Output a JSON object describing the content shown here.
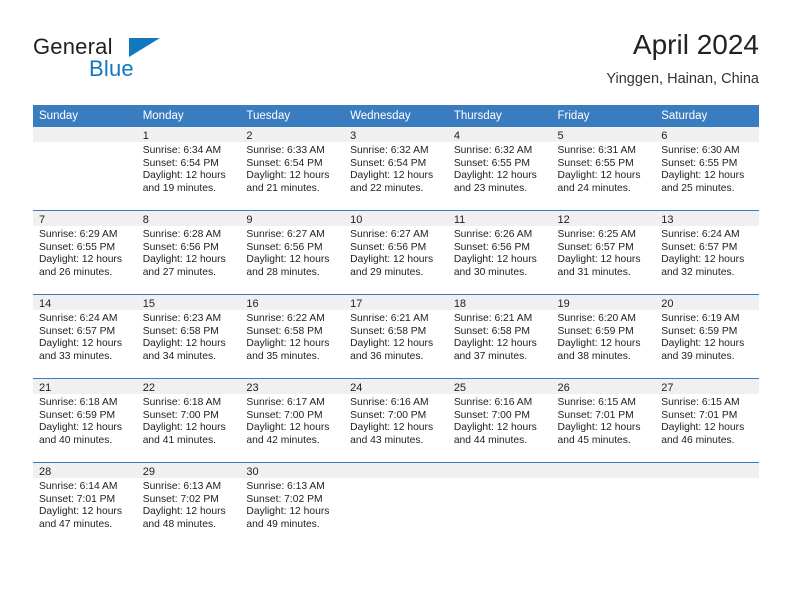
{
  "brand": {
    "word_one": "General",
    "word_two": "Blue",
    "triangle_icon": "triangle-icon",
    "accent_color": "#1278be"
  },
  "header": {
    "title": "April 2024",
    "subtitle": "Yinggen, Hainan, China"
  },
  "theme": {
    "header_blue": "#3a7cc0",
    "daynum_band": "#f0f0f0",
    "text": "#222222"
  },
  "calendar": {
    "weekday_headers": [
      "Sunday",
      "Monday",
      "Tuesday",
      "Wednesday",
      "Thursday",
      "Friday",
      "Saturday"
    ],
    "weeks": [
      [
        {
          "day": "",
          "sunrise": "",
          "sunset": "",
          "daylight_1": "",
          "daylight_2": ""
        },
        {
          "day": "1",
          "sunrise": "Sunrise: 6:34 AM",
          "sunset": "Sunset: 6:54 PM",
          "daylight_1": "Daylight: 12 hours",
          "daylight_2": "and 19 minutes."
        },
        {
          "day": "2",
          "sunrise": "Sunrise: 6:33 AM",
          "sunset": "Sunset: 6:54 PM",
          "daylight_1": "Daylight: 12 hours",
          "daylight_2": "and 21 minutes."
        },
        {
          "day": "3",
          "sunrise": "Sunrise: 6:32 AM",
          "sunset": "Sunset: 6:54 PM",
          "daylight_1": "Daylight: 12 hours",
          "daylight_2": "and 22 minutes."
        },
        {
          "day": "4",
          "sunrise": "Sunrise: 6:32 AM",
          "sunset": "Sunset: 6:55 PM",
          "daylight_1": "Daylight: 12 hours",
          "daylight_2": "and 23 minutes."
        },
        {
          "day": "5",
          "sunrise": "Sunrise: 6:31 AM",
          "sunset": "Sunset: 6:55 PM",
          "daylight_1": "Daylight: 12 hours",
          "daylight_2": "and 24 minutes."
        },
        {
          "day": "6",
          "sunrise": "Sunrise: 6:30 AM",
          "sunset": "Sunset: 6:55 PM",
          "daylight_1": "Daylight: 12 hours",
          "daylight_2": "and 25 minutes."
        }
      ],
      [
        {
          "day": "7",
          "sunrise": "Sunrise: 6:29 AM",
          "sunset": "Sunset: 6:55 PM",
          "daylight_1": "Daylight: 12 hours",
          "daylight_2": "and 26 minutes."
        },
        {
          "day": "8",
          "sunrise": "Sunrise: 6:28 AM",
          "sunset": "Sunset: 6:56 PM",
          "daylight_1": "Daylight: 12 hours",
          "daylight_2": "and 27 minutes."
        },
        {
          "day": "9",
          "sunrise": "Sunrise: 6:27 AM",
          "sunset": "Sunset: 6:56 PM",
          "daylight_1": "Daylight: 12 hours",
          "daylight_2": "and 28 minutes."
        },
        {
          "day": "10",
          "sunrise": "Sunrise: 6:27 AM",
          "sunset": "Sunset: 6:56 PM",
          "daylight_1": "Daylight: 12 hours",
          "daylight_2": "and 29 minutes."
        },
        {
          "day": "11",
          "sunrise": "Sunrise: 6:26 AM",
          "sunset": "Sunset: 6:56 PM",
          "daylight_1": "Daylight: 12 hours",
          "daylight_2": "and 30 minutes."
        },
        {
          "day": "12",
          "sunrise": "Sunrise: 6:25 AM",
          "sunset": "Sunset: 6:57 PM",
          "daylight_1": "Daylight: 12 hours",
          "daylight_2": "and 31 minutes."
        },
        {
          "day": "13",
          "sunrise": "Sunrise: 6:24 AM",
          "sunset": "Sunset: 6:57 PM",
          "daylight_1": "Daylight: 12 hours",
          "daylight_2": "and 32 minutes."
        }
      ],
      [
        {
          "day": "14",
          "sunrise": "Sunrise: 6:24 AM",
          "sunset": "Sunset: 6:57 PM",
          "daylight_1": "Daylight: 12 hours",
          "daylight_2": "and 33 minutes."
        },
        {
          "day": "15",
          "sunrise": "Sunrise: 6:23 AM",
          "sunset": "Sunset: 6:58 PM",
          "daylight_1": "Daylight: 12 hours",
          "daylight_2": "and 34 minutes."
        },
        {
          "day": "16",
          "sunrise": "Sunrise: 6:22 AM",
          "sunset": "Sunset: 6:58 PM",
          "daylight_1": "Daylight: 12 hours",
          "daylight_2": "and 35 minutes."
        },
        {
          "day": "17",
          "sunrise": "Sunrise: 6:21 AM",
          "sunset": "Sunset: 6:58 PM",
          "daylight_1": "Daylight: 12 hours",
          "daylight_2": "and 36 minutes."
        },
        {
          "day": "18",
          "sunrise": "Sunrise: 6:21 AM",
          "sunset": "Sunset: 6:58 PM",
          "daylight_1": "Daylight: 12 hours",
          "daylight_2": "and 37 minutes."
        },
        {
          "day": "19",
          "sunrise": "Sunrise: 6:20 AM",
          "sunset": "Sunset: 6:59 PM",
          "daylight_1": "Daylight: 12 hours",
          "daylight_2": "and 38 minutes."
        },
        {
          "day": "20",
          "sunrise": "Sunrise: 6:19 AM",
          "sunset": "Sunset: 6:59 PM",
          "daylight_1": "Daylight: 12 hours",
          "daylight_2": "and 39 minutes."
        }
      ],
      [
        {
          "day": "21",
          "sunrise": "Sunrise: 6:18 AM",
          "sunset": "Sunset: 6:59 PM",
          "daylight_1": "Daylight: 12 hours",
          "daylight_2": "and 40 minutes."
        },
        {
          "day": "22",
          "sunrise": "Sunrise: 6:18 AM",
          "sunset": "Sunset: 7:00 PM",
          "daylight_1": "Daylight: 12 hours",
          "daylight_2": "and 41 minutes."
        },
        {
          "day": "23",
          "sunrise": "Sunrise: 6:17 AM",
          "sunset": "Sunset: 7:00 PM",
          "daylight_1": "Daylight: 12 hours",
          "daylight_2": "and 42 minutes."
        },
        {
          "day": "24",
          "sunrise": "Sunrise: 6:16 AM",
          "sunset": "Sunset: 7:00 PM",
          "daylight_1": "Daylight: 12 hours",
          "daylight_2": "and 43 minutes."
        },
        {
          "day": "25",
          "sunrise": "Sunrise: 6:16 AM",
          "sunset": "Sunset: 7:00 PM",
          "daylight_1": "Daylight: 12 hours",
          "daylight_2": "and 44 minutes."
        },
        {
          "day": "26",
          "sunrise": "Sunrise: 6:15 AM",
          "sunset": "Sunset: 7:01 PM",
          "daylight_1": "Daylight: 12 hours",
          "daylight_2": "and 45 minutes."
        },
        {
          "day": "27",
          "sunrise": "Sunrise: 6:15 AM",
          "sunset": "Sunset: 7:01 PM",
          "daylight_1": "Daylight: 12 hours",
          "daylight_2": "and 46 minutes."
        }
      ],
      [
        {
          "day": "28",
          "sunrise": "Sunrise: 6:14 AM",
          "sunset": "Sunset: 7:01 PM",
          "daylight_1": "Daylight: 12 hours",
          "daylight_2": "and 47 minutes."
        },
        {
          "day": "29",
          "sunrise": "Sunrise: 6:13 AM",
          "sunset": "Sunset: 7:02 PM",
          "daylight_1": "Daylight: 12 hours",
          "daylight_2": "and 48 minutes."
        },
        {
          "day": "30",
          "sunrise": "Sunrise: 6:13 AM",
          "sunset": "Sunset: 7:02 PM",
          "daylight_1": "Daylight: 12 hours",
          "daylight_2": "and 49 minutes."
        },
        {
          "day": "",
          "sunrise": "",
          "sunset": "",
          "daylight_1": "",
          "daylight_2": ""
        },
        {
          "day": "",
          "sunrise": "",
          "sunset": "",
          "daylight_1": "",
          "daylight_2": ""
        },
        {
          "day": "",
          "sunrise": "",
          "sunset": "",
          "daylight_1": "",
          "daylight_2": ""
        },
        {
          "day": "",
          "sunrise": "",
          "sunset": "",
          "daylight_1": "",
          "daylight_2": ""
        }
      ]
    ]
  }
}
